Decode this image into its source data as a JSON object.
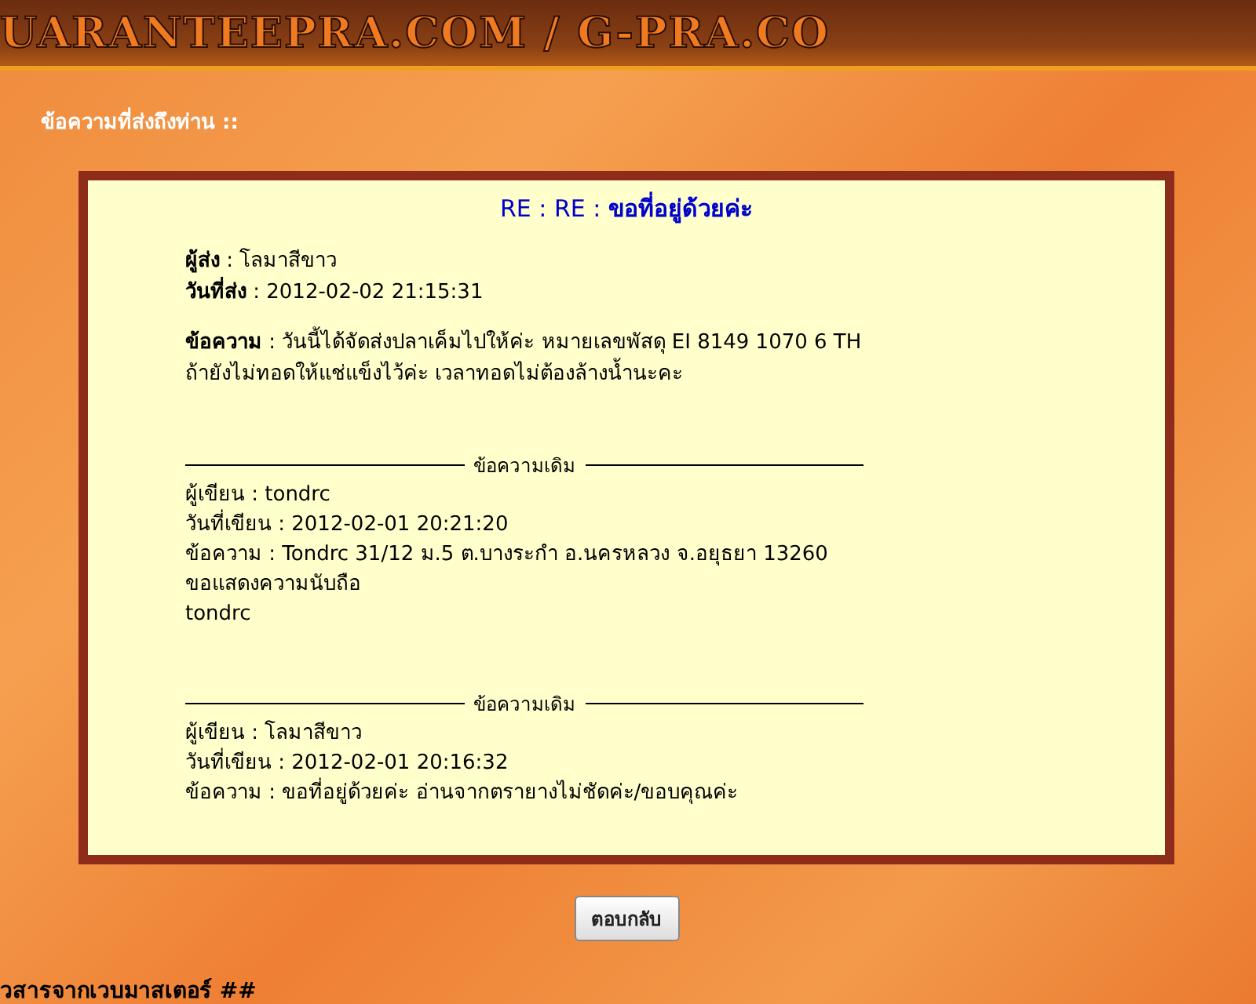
{
  "banner": {
    "text": "UARANTEEPRA.COM / G-PRA.CO"
  },
  "heading": "ข้อความที่ส่งถึงท่าน ::",
  "message": {
    "subject": "RE : RE : **ขอที่อยู่ด้วยค่ะ**",
    "fields": [
      "**ผู้ส่ง** : โลมาสีขาว",
      "**วันที่ส่ง** : 2012-02-02 21:15:31"
    ],
    "body": [
      "**ข้อความ** : วันนี้ได้จัดส่งปลาเค็มไปให้ค่ะ หมายเลขพัสดุ EI 8149 1070 6 TH",
      "ถ้ายังไม่ทอดให้แช่แข็งไว้ค่ะ เวลาทอดไม่ต้องล้างน้ำนะคะ"
    ],
    "quotes": [
      {
        "divider_label": "ข้อความเดิม",
        "lines": [
          "ผู้เขียน : tondrc",
          "วันที่เขียน : 2012-02-01 20:21:20",
          "ข้อความ : Tondrc 31/12 ม.5 ต.บางระกำ อ.นครหลวง จ.อยุธยา 13260",
          "ขอแสดงความนับถือ",
          "tondrc"
        ]
      },
      {
        "divider_label": "ข้อความเดิม",
        "lines": [
          "ผู้เขียน : โลมาสีขาว",
          "วันที่เขียน : 2012-02-01 20:16:32",
          "ข้อความ : ขอที่อยู่ด้วยค่ะ อ่านจากตรายางไม่ชัดค่ะ/ขอบคุณค่ะ"
        ]
      }
    ]
  },
  "reply_button": "ตอบกลับ",
  "footer_text": "วสารจากเวบมาสเตอร์ ##"
}
